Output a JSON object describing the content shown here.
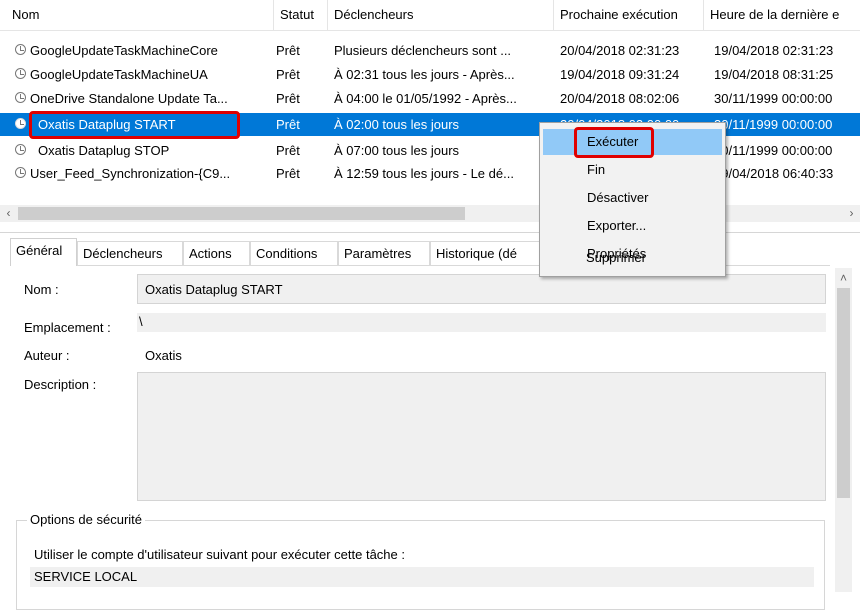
{
  "columns": [
    "Nom",
    "Statut",
    "Déclencheurs",
    "Prochaine exécution",
    "Heure de la dernière e"
  ],
  "tasks": [
    {
      "name": "GoogleUpdateTaskMachineCore",
      "status": "Prêt",
      "trigger": "Plusieurs déclencheurs sont ...",
      "next": "20/04/2018 02:31:23",
      "last": "19/04/2018 02:31:23"
    },
    {
      "name": "GoogleUpdateTaskMachineUA",
      "status": "Prêt",
      "trigger": "À 02:31 tous les jours - Après...",
      "next": "19/04/2018 09:31:24",
      "last": "19/04/2018 08:31:25"
    },
    {
      "name": "OneDrive Standalone Update Ta...",
      "status": "Prêt",
      "trigger": "À 04:00 le 01/05/1992 - Après...",
      "next": "20/04/2018 08:02:06",
      "last": "30/11/1999 00:00:00"
    },
    {
      "name": "Oxatis Dataplug START",
      "status": "Prêt",
      "trigger": "À 02:00 tous les jours",
      "next": "20/04/2018 02:00:00",
      "last": "30/11/1999 00:00:00"
    },
    {
      "name": "Oxatis Dataplug STOP",
      "status": "Prêt",
      "trigger": "À 07:00 tous les jours",
      "next": "",
      "last": "30/11/1999 00:00:00"
    },
    {
      "name": "User_Feed_Synchronization-{C9...",
      "status": "Prêt",
      "trigger": "À 12:59 tous les jours - Le dé...",
      "next": "",
      "last": "19/04/2018 06:40:33"
    }
  ],
  "context_menu": [
    "Exécuter",
    "Fin",
    "Désactiver",
    "Exporter...",
    "Propriétés",
    "Supprimer"
  ],
  "tabs": [
    "Général",
    "Déclencheurs",
    "Actions",
    "Conditions",
    "Paramètres",
    "Historique (dé"
  ],
  "general": {
    "name_label": "Nom :",
    "name_value": "Oxatis Dataplug START",
    "location_label": "Emplacement :",
    "location_value": "\\",
    "author_label": "Auteur :",
    "author_value": "Oxatis",
    "description_label": "Description :",
    "description_value": "",
    "security_label": "Options de sécurité",
    "account_prompt": "Utiliser le compte d'utilisateur suivant pour exécuter cette tâche :",
    "account_value": "SERVICE LOCAL"
  },
  "colors": {
    "selection": "#0078d7",
    "menu_highlight": "#91c9f7",
    "annotation": "#e00000"
  }
}
